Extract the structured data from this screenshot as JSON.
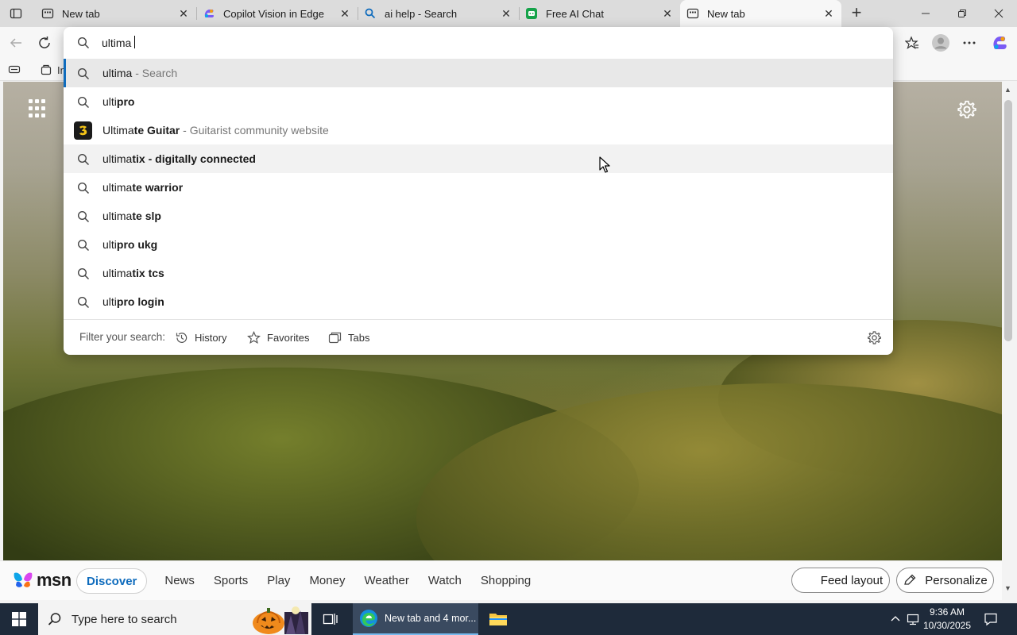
{
  "tabs": [
    {
      "title": "New tab",
      "icon": "newtab-icon"
    },
    {
      "title": "Copilot Vision in Edge",
      "icon": "copilot-icon"
    },
    {
      "title": "ai help - Search",
      "icon": "search-icon"
    },
    {
      "title": "Free AI Chat",
      "icon": "chat-icon"
    },
    {
      "title": "New tab",
      "icon": "newtab-icon"
    }
  ],
  "favorites_bar": {
    "first_item_partial": "In"
  },
  "omnibox": {
    "value": "ultima",
    "suggestions": [
      {
        "prefix": "ultima",
        "bold": "",
        "suffix": " - Search",
        "type": "search"
      },
      {
        "prefix": "ulti",
        "bold": "pro",
        "suffix": "",
        "type": "search"
      },
      {
        "prefix": "Ultima",
        "bold": "te Guitar",
        "suffix": " - Guitarist community website",
        "type": "site"
      },
      {
        "prefix": "ultima",
        "bold": "tix - digitally connected",
        "suffix": "",
        "type": "search"
      },
      {
        "prefix": "ultima",
        "bold": "te warrior",
        "suffix": "",
        "type": "search"
      },
      {
        "prefix": "ultima",
        "bold": "te slp",
        "suffix": "",
        "type": "search"
      },
      {
        "prefix": "ulti",
        "bold": "pro ukg",
        "suffix": "",
        "type": "search"
      },
      {
        "prefix": "ultima",
        "bold": "tix tcs",
        "suffix": "",
        "type": "search"
      },
      {
        "prefix": "ulti",
        "bold": "pro login",
        "suffix": "",
        "type": "search"
      }
    ],
    "filter_label": "Filter your search:",
    "filters": [
      "History",
      "Favorites",
      "Tabs"
    ]
  },
  "msn": {
    "logo": "msn",
    "nav": [
      "Discover",
      "News",
      "Sports",
      "Play",
      "Money",
      "Weather",
      "Watch",
      "Shopping"
    ],
    "feed_layout": "Feed layout",
    "personalize": "Personalize"
  },
  "taskbar": {
    "search_placeholder": "Type here to search",
    "edge_task": "New tab and 4 mor...",
    "time": "9:36 AM",
    "date": "10/30/2025"
  },
  "colors": {
    "accent": "#0f6cbd",
    "taskbar": "#1e2a3a"
  }
}
